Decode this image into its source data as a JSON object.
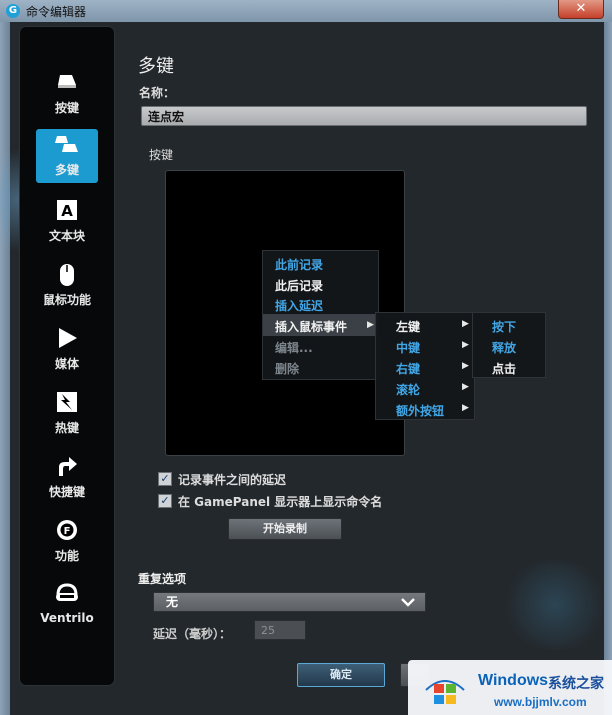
{
  "window": {
    "title": "命令编辑器",
    "close_glyph": "✕",
    "app_icon": "G"
  },
  "sidebar": {
    "items": [
      {
        "label": "按键",
        "icon": "key-icon",
        "glyph": "⌨",
        "active": false
      },
      {
        "label": "多键",
        "icon": "multikey-icon",
        "glyph": "⌨",
        "active": true
      },
      {
        "label": "文本块",
        "icon": "text-block-icon",
        "glyph": "A",
        "active": false
      },
      {
        "label": "鼠标功能",
        "icon": "mouse-icon",
        "glyph": "●",
        "active": false
      },
      {
        "label": "媒体",
        "icon": "media-play-icon",
        "glyph": "▶",
        "active": false
      },
      {
        "label": "热键",
        "icon": "hotkey-icon",
        "glyph": "⚡",
        "active": false
      },
      {
        "label": "快捷键",
        "icon": "shortcut-arrow-icon",
        "glyph": "➦",
        "active": false
      },
      {
        "label": "功能",
        "icon": "function-gear-icon",
        "glyph": "⚙",
        "active": false
      },
      {
        "label": "Ventrilo",
        "icon": "headset-icon",
        "glyph": "☊",
        "active": false
      }
    ]
  },
  "main": {
    "title": "多键",
    "name_label": "名称：",
    "name_value": "连点宏",
    "keys_label": "按键"
  },
  "context_menu": {
    "items": [
      {
        "label": "此前记录",
        "style": "blue"
      },
      {
        "label": "此后记录",
        "style": "white"
      },
      {
        "label": "插入延迟",
        "style": "blue"
      },
      {
        "label": "插入鼠标事件",
        "style": "white",
        "submenu": true,
        "highlighted": true
      },
      {
        "label": "编辑...",
        "style": "gray"
      },
      {
        "label": "删除",
        "style": "gray"
      }
    ],
    "submenu_mouse": [
      {
        "label": "左键",
        "style": "white",
        "submenu": true
      },
      {
        "label": "中键",
        "style": "blue",
        "submenu": true
      },
      {
        "label": "右键",
        "style": "blue",
        "submenu": true
      },
      {
        "label": "滚轮",
        "style": "blue",
        "submenu": true
      },
      {
        "label": "额外按钮",
        "style": "blue",
        "submenu": true
      }
    ],
    "submenu_button": [
      {
        "label": "按下",
        "style": "blue"
      },
      {
        "label": "释放",
        "style": "blue"
      },
      {
        "label": "点击",
        "style": "white"
      }
    ],
    "arrow_glyph": "▶"
  },
  "options": {
    "record_delays_label": "记录事件之间的延迟",
    "record_delays_checked": true,
    "show_name_label": "在 GamePanel 显示器上显示命令名",
    "show_name_checked": true,
    "check_glyph": "✓",
    "start_record_button": "开始录制"
  },
  "repeat": {
    "label": "重复选项",
    "selected": "无",
    "delay_label": "延迟（毫秒）：",
    "delay_value": "25"
  },
  "footer": {
    "ok_button": "确定"
  },
  "watermark": {
    "brand": "Windows",
    "subtitle": "系统之家",
    "url": "www.bjjmlv.com"
  },
  "colors": {
    "accent": "#1c9bd1",
    "menu_blue": "#41a6e6",
    "sidebar_bg": "#070809",
    "window_bg": "#23282c"
  }
}
